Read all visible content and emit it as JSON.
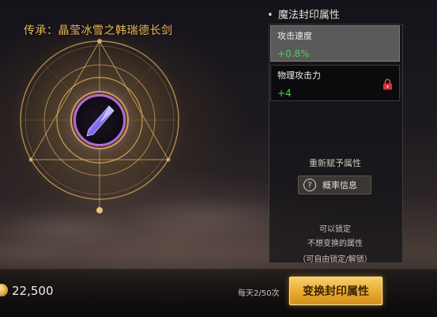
{
  "inheritance": {
    "title": "传承：晶莹冰雪之韩瑞德长剑",
    "item_icon": "crystal-sword-icon"
  },
  "panel": {
    "bullet": "•",
    "title": "魔法封印属性",
    "attributes": [
      {
        "name": "攻击速度",
        "value": "+0.8%",
        "locked": false
      },
      {
        "name": "物理攻击力",
        "value": "+4",
        "locked": true
      }
    ],
    "reroll_label": "重新赋予属性",
    "prob_button": {
      "icon_glyph": "?",
      "label": "概率信息"
    },
    "hints": [
      "可以锁定",
      "不想变换的属性",
      "（可自由锁定/解锁）"
    ]
  },
  "footer": {
    "currency_icon": "gold-coin-icon",
    "gold": "22,500",
    "daily_limit": "每天2/50次",
    "change_button": "变换封印属性"
  },
  "colors": {
    "accent_gold": "#e8b757",
    "value_green": "#5fd05a",
    "lock_red": "#d8323a",
    "button_gold": "#e9a92f",
    "gem_purple": "#b06ad8"
  }
}
